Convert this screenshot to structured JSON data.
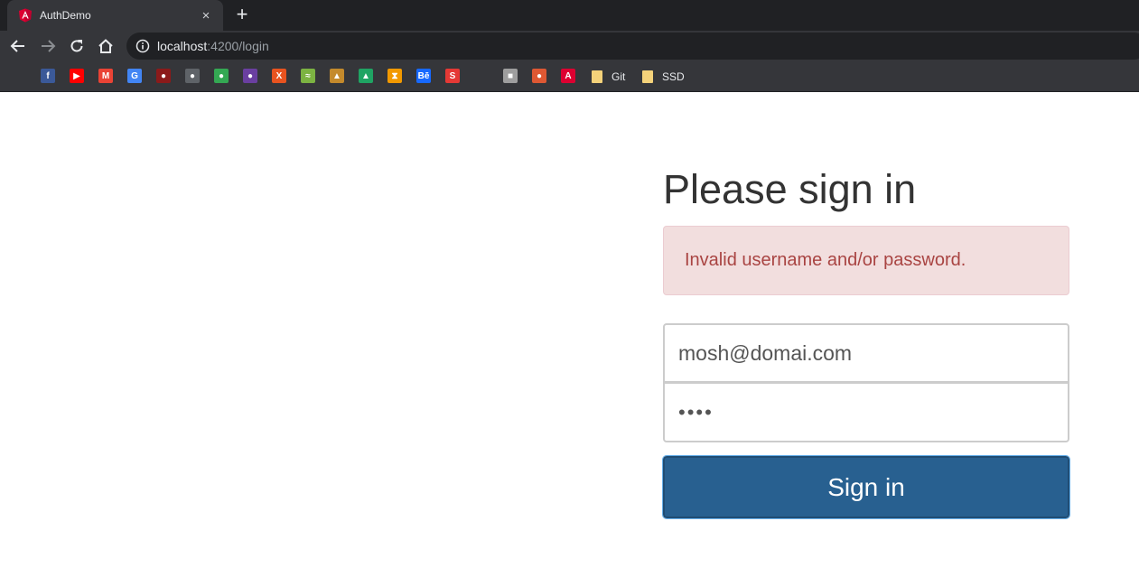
{
  "browser": {
    "tab": {
      "title": "AuthDemo",
      "close": "×"
    },
    "new_tab": "+",
    "address": {
      "host": "localhost",
      "path": ":4200/login"
    },
    "bookmarks": [
      {
        "name": "facebook",
        "glyph": "f",
        "color": "#3b5998"
      },
      {
        "name": "youtube",
        "glyph": "▶",
        "color": "#ff0000"
      },
      {
        "name": "gmail",
        "glyph": "M",
        "color": "#ea4335"
      },
      {
        "name": "google-translate",
        "glyph": "G",
        "color": "#4285f4"
      },
      {
        "name": "game",
        "glyph": "●",
        "color": "#8b1a1a"
      },
      {
        "name": "incognito",
        "glyph": "●",
        "color": "#5f6368"
      },
      {
        "name": "owl",
        "glyph": "●",
        "color": "#34a853"
      },
      {
        "name": "emblem",
        "glyph": "●",
        "color": "#6a3fa0"
      },
      {
        "name": "x-brand",
        "glyph": "X",
        "color": "#e8531f"
      },
      {
        "name": "chart-brand",
        "glyph": "≈",
        "color": "#7cb342"
      },
      {
        "name": "temple",
        "glyph": "▲",
        "color": "#c48a2c"
      },
      {
        "name": "google-drive",
        "glyph": "▲",
        "color": "#1fa463"
      },
      {
        "name": "hourglass",
        "glyph": "⧗",
        "color": "#f29900"
      },
      {
        "name": "behance",
        "glyph": "Bē",
        "color": "#1769ff"
      },
      {
        "name": "red-app",
        "glyph": "S",
        "color": "#e53935"
      },
      {
        "name": "tool",
        "glyph": "■",
        "color": "#9e9e9e"
      },
      {
        "name": "duckduckgo",
        "glyph": "●",
        "color": "#de5833"
      },
      {
        "name": "angular",
        "glyph": "A",
        "color": "#dd0031"
      }
    ],
    "folders": [
      {
        "label": "Git"
      },
      {
        "label": "SSD"
      }
    ]
  },
  "page": {
    "heading": "Please sign in",
    "alert": "Invalid username and/or password.",
    "email": {
      "value": "mosh@domai.com"
    },
    "password": {
      "masked": "••••"
    },
    "submit": "Sign in"
  }
}
